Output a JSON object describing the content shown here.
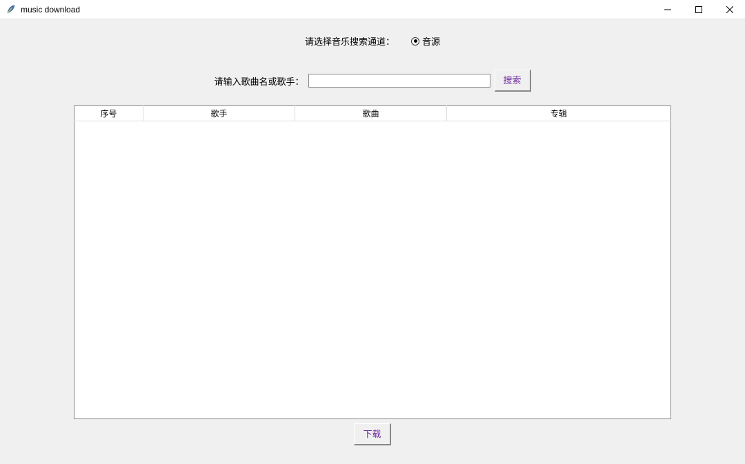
{
  "window": {
    "title": "music download"
  },
  "channel": {
    "label": "请选择音乐搜索通道：",
    "options": [
      {
        "label": "音源",
        "selected": true
      }
    ]
  },
  "search": {
    "label": "请输入歌曲名或歌手：",
    "value": "",
    "button_label": "搜索"
  },
  "table": {
    "columns": {
      "index": "序号",
      "artist": "歌手",
      "song": "歌曲",
      "album": "专辑"
    },
    "rows": []
  },
  "download": {
    "button_label": "下载"
  }
}
